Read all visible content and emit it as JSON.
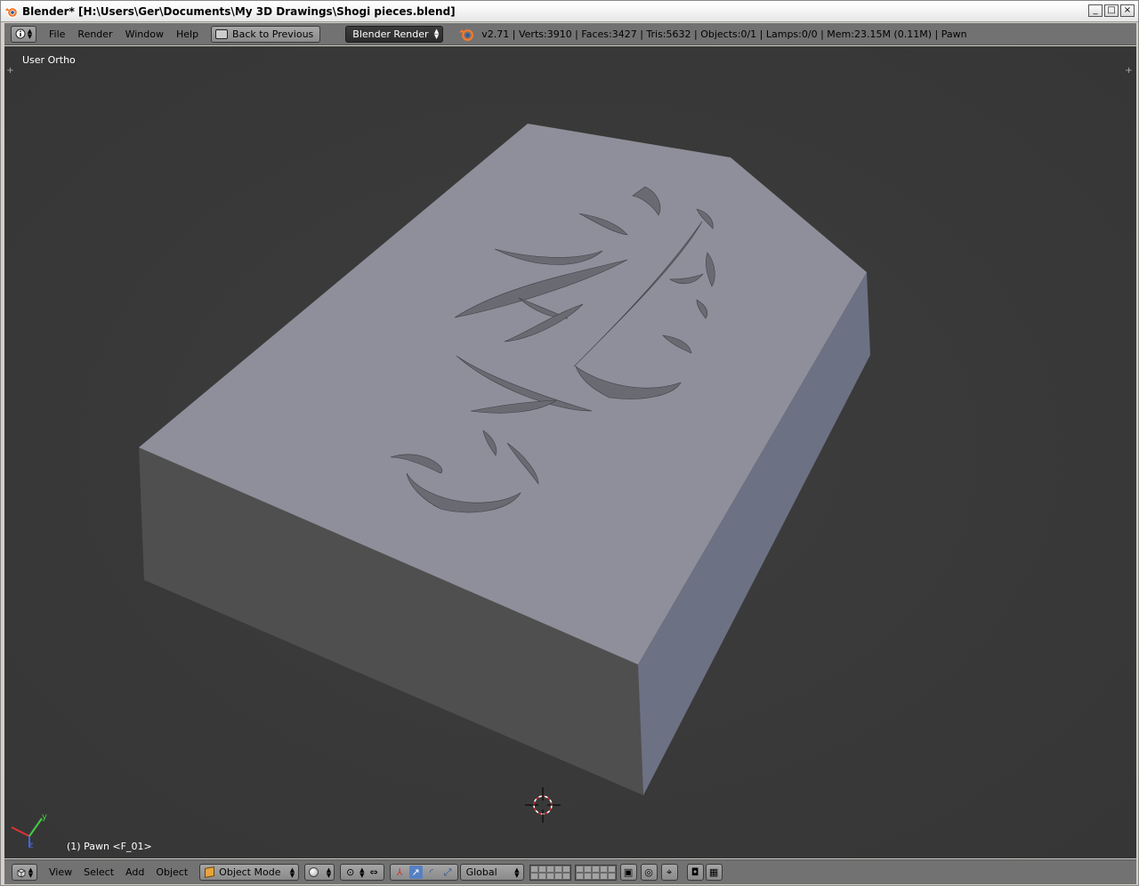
{
  "window": {
    "title": "Blender* [H:\\Users\\Ger\\Documents\\My 3D Drawings\\Shogi pieces.blend]",
    "controls": [
      "_",
      "□",
      "×"
    ]
  },
  "info_header": {
    "menus": [
      "File",
      "Render",
      "Window",
      "Help"
    ],
    "back_button": "Back to Previous",
    "render_engine": "Blender Render",
    "stats": "v2.71 | Verts:3910 | Faces:3427 | Tris:5632 | Objects:0/1 | Lamps:0/0 | Mem:23.15M (0.11M) | Pawn"
  },
  "viewport": {
    "view_label": "User Ortho",
    "object_info": "(1) Pawn <F_01>",
    "background_color": "#393939",
    "axis_labels": [
      "y",
      "z"
    ]
  },
  "view3d_header": {
    "menus": [
      "View",
      "Select",
      "Add",
      "Object"
    ],
    "mode": "Object Mode",
    "orientation": "Global"
  },
  "colors": {
    "header_bg": "#727272",
    "top_face": "#8e8f9a",
    "front_face": "#505050",
    "side_face": "#6d7184",
    "active_tool": "#5680c2"
  }
}
